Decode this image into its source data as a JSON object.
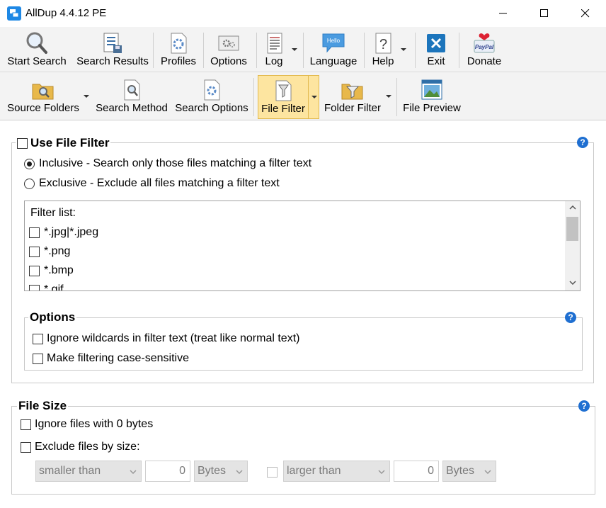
{
  "window": {
    "title": "AllDup 4.4.12 PE",
    "controls": [
      "minimize",
      "maximize",
      "close"
    ]
  },
  "toolbar_main": {
    "items": [
      {
        "label": "Start Search",
        "icon": "magnifier-icon"
      },
      {
        "label": "Search Results",
        "icon": "results-list-icon"
      },
      {
        "label": "Profiles",
        "icon": "profile-gear-icon"
      },
      {
        "label": "Options",
        "icon": "options-icon"
      },
      {
        "label": "Log",
        "icon": "log-icon"
      },
      {
        "label": "Language",
        "icon": "hello-bubble-icon"
      },
      {
        "label": "Help",
        "icon": "question-icon"
      },
      {
        "label": "Exit",
        "icon": "exit-x-icon"
      },
      {
        "label": "Donate",
        "icon": "paypal-icon"
      }
    ],
    "hello_text": "Hello",
    "paypal_text": "PayPal"
  },
  "toolbar_tabs": {
    "items": [
      {
        "label": "Source Folders",
        "icon": "folder-magnifier-icon"
      },
      {
        "label": "Search Method",
        "icon": "page-magnifier-icon"
      },
      {
        "label": "Search Options",
        "icon": "page-gear-icon"
      },
      {
        "label": "File Filter",
        "icon": "filter-page-icon",
        "active": true
      },
      {
        "label": "Folder Filter",
        "icon": "filter-folder-icon"
      },
      {
        "label": "File Preview",
        "icon": "preview-window-icon"
      }
    ]
  },
  "file_filter": {
    "title": "Use File Filter",
    "enabled": false,
    "inclusive_label": "Inclusive - Search only those files matching a filter text",
    "exclusive_label": "Exclusive - Exclude all files matching a filter text",
    "mode": "inclusive",
    "filter_list_header": "Filter list:",
    "filters": [
      {
        "text": "*.jpg|*.jpeg",
        "checked": false
      },
      {
        "text": "*.png",
        "checked": false
      },
      {
        "text": "*.bmp",
        "checked": false
      },
      {
        "text": "*.gif",
        "checked": false
      }
    ],
    "options": {
      "title": "Options",
      "ignore_wildcards": "Ignore wildcards in filter text (treat like normal text)",
      "case_sensitive": "Make filtering case-sensitive"
    }
  },
  "file_size": {
    "title": "File Size",
    "ignore_zero": "Ignore files with 0 bytes",
    "exclude_by_size": "Exclude files by size:",
    "min_comparator": "smaller than",
    "min_value": "0",
    "min_unit": "Bytes",
    "max_comparator": "larger than",
    "max_value": "0",
    "max_unit": "Bytes"
  },
  "help_symbol": "?",
  "colors": {
    "accent_help": "#1f6fd1",
    "active_tab_bg": "#fde5a0",
    "exit_blue": "#1c75bc"
  }
}
